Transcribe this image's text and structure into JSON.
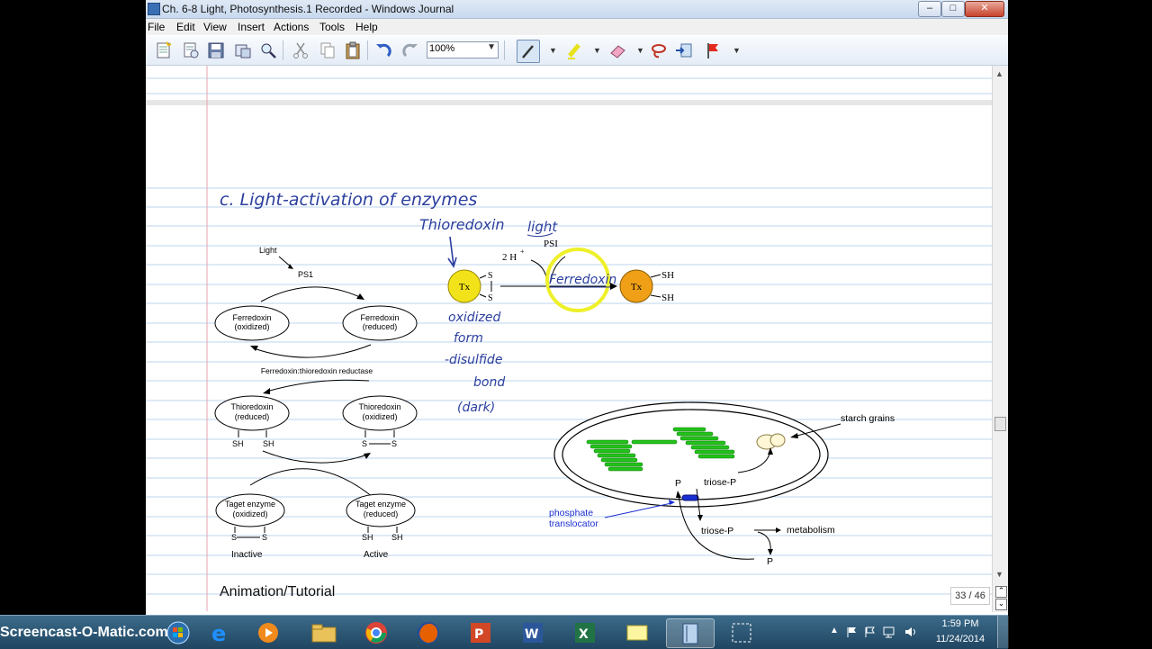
{
  "window": {
    "title": "Ch. 6-8 Light, Photosynthesis.1 Recorded - Windows Journal",
    "minimize": "–",
    "maximize": "□",
    "close": "✕"
  },
  "menu": {
    "file": "File",
    "edit": "Edit",
    "view": "View",
    "insert": "Insert",
    "actions": "Actions",
    "tools": "Tools",
    "help": "Help"
  },
  "toolbar": {
    "zoom": "100%"
  },
  "note": {
    "heading": "c. Light-activation of enzymes",
    "thioredoxin": "Thioredoxin",
    "light": "light",
    "ferredoxin": "Ferredoxin",
    "oxidized_form": [
      "oxidized",
      "form",
      "-disulfide",
      "bond",
      "(dark)"
    ],
    "footer": "Animation/Tutorial"
  },
  "cycle_diagram": {
    "light": "Light",
    "ps1": "PS1",
    "ferredoxin_oxidized": [
      "Ferredoxin",
      "(oxidized)"
    ],
    "ferredoxin_reduced": [
      "Ferredoxin",
      "(reduced)"
    ],
    "reductase": "Ferredoxin:thioredoxin reductase",
    "thioredoxin_reduced": [
      "Thioredoxin",
      "(reduced)"
    ],
    "thioredoxin_oxidized": [
      "Thioredoxin",
      "(oxidized)"
    ],
    "target_oxidized": [
      "Taget enzyme",
      "(oxidized)"
    ],
    "target_reduced": [
      "Taget enzyme",
      "(reduced)"
    ],
    "sh": "SH",
    "s": "S",
    "inactive": "Inactive",
    "active": "Active"
  },
  "tx_diagram": {
    "tx": "Tx",
    "s": "S",
    "sh": "SH",
    "two_h": "2 H",
    "plus": "+",
    "psi": "PSI"
  },
  "chloroplast": {
    "starch_grains": "starch grains",
    "p": "P",
    "triose_p": "triose-P",
    "phosphate_translocator": [
      "phosphate",
      "translocator"
    ],
    "metabolism": "metabolism"
  },
  "status": {
    "page_counter": "33 / 46"
  },
  "watermark": "Screencast-O-Matic.com",
  "taskbar": {
    "time": "1:59 PM",
    "date": "11/24/2014"
  },
  "colors": {
    "ink": "#2b3f9e",
    "ruling": "#bcd4ec",
    "margin": "#e3a6b1",
    "tx_yellow": "#f2e21a",
    "tx_orange": "#f0a016",
    "highlight": "#eef02a",
    "grana": "#22c21a"
  }
}
